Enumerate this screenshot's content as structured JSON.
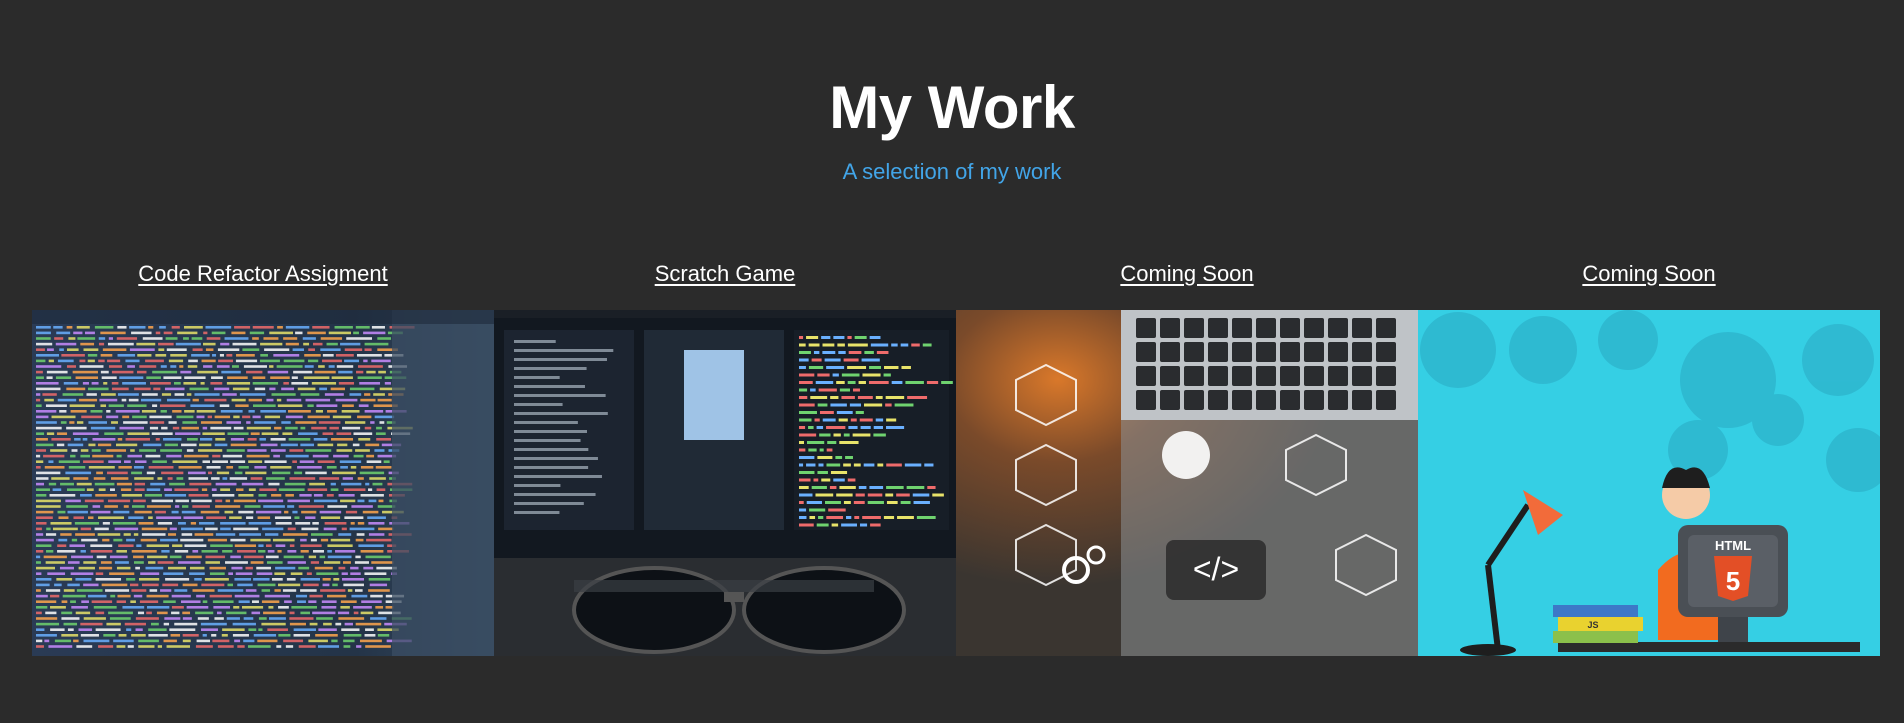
{
  "header": {
    "title": "My Work",
    "subtitle": "A selection of my work"
  },
  "projects": [
    {
      "title": "Code Refactor Assigment",
      "image": "code-screen-photo"
    },
    {
      "title": "Scratch Game",
      "image": "monitors-with-glasses-photo"
    },
    {
      "title": "Coming Soon",
      "image": "laptop-tech-icons-photo"
    },
    {
      "title": "Coming Soon",
      "image": "html5-developer-illustration"
    }
  ],
  "colors": {
    "background": "#2b2b2b",
    "subtitle": "#42a5e8",
    "text": "#ffffff"
  },
  "illustration": {
    "html_label": "HTML",
    "html_badge": "5",
    "book_label": "JS"
  }
}
